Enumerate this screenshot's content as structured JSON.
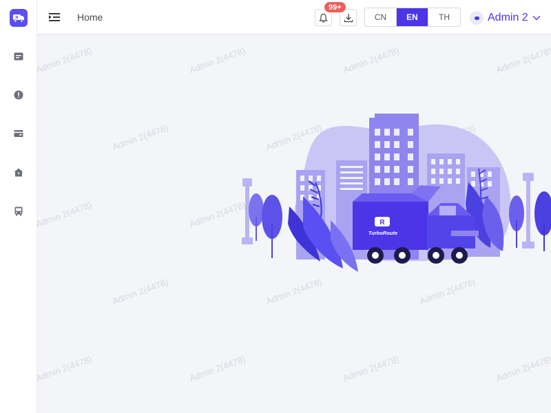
{
  "header": {
    "breadcrumb": "Home",
    "notification_badge": "99+",
    "languages": [
      "CN",
      "EN",
      "TH"
    ],
    "active_language": "EN",
    "user_name": "Admin 2"
  },
  "sidebar": {
    "items": [
      {
        "icon": "list-card-icon"
      },
      {
        "icon": "alert-circle-icon"
      },
      {
        "icon": "wallet-icon"
      },
      {
        "icon": "home-bolt-icon"
      },
      {
        "icon": "bus-icon"
      }
    ]
  },
  "illustration": {
    "truck_label": "TurboRoute"
  },
  "watermark": {
    "text": "Admin 2(4478)"
  },
  "colors": {
    "accent": "#4b35e6",
    "badge": "#ef5d5d",
    "background": "#f4f5f9"
  }
}
